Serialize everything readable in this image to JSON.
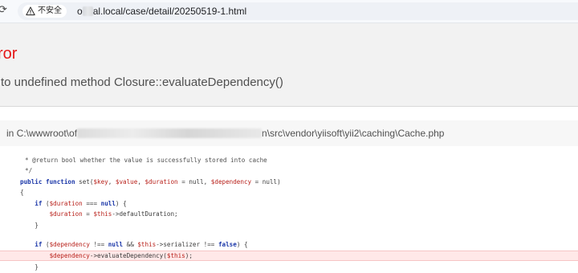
{
  "browser": {
    "reload_glyph": "⟳",
    "security_label": "不安全",
    "url_prefix": "o",
    "url_suffix": "al.local/case/detail/20250519-1.html",
    "icons": [
      "reload-icon",
      "warning-icon"
    ]
  },
  "error": {
    "title": "ror",
    "message": "to undefined method Closure::evaluateDependency()"
  },
  "file": {
    "path_prefix": "in C:\\wwwroot\\of",
    "path_suffix": "n\\src\\vendor\\yiisoft\\yii2\\caching\\Cache.php"
  },
  "code": {
    "lines": [
      "* @return bool whether the value is successfully stored into cache",
      "*/",
      "public function set($key, $value, $duration = null, $dependency = null)",
      "{",
      "    if ($duration === null) {",
      "        $duration = $this->defaultDuration;",
      "    }",
      "",
      "    if ($dependency !== null && $this->serializer !== false) {",
      "        $dependency->evaluateDependency($this);",
      "    }"
    ],
    "highlighted_line": "$dependency->evaluateDependency($this);"
  },
  "colors": {
    "error_red": "#e51717",
    "highlight_bg": "#ffe8e8",
    "keyword_blue": "#1a36a8",
    "variable_red": "#b8201a"
  }
}
